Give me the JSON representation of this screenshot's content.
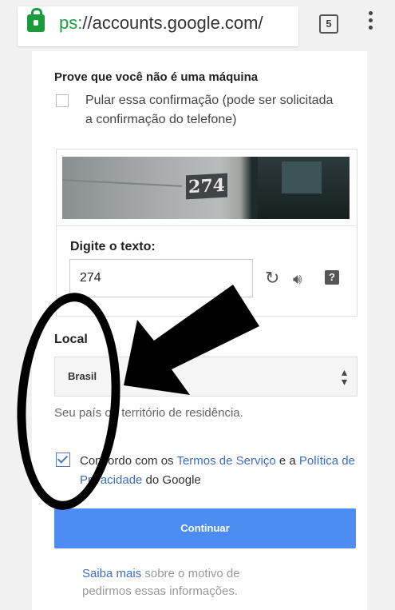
{
  "browser": {
    "url_scheme": "ps:",
    "url_rest": "//accounts.google.com/",
    "tab_count": "5"
  },
  "form": {
    "prove_title": "Prove que você não é uma máquina",
    "skip_label": "Pular essa confirmação (pode ser solicitada a confirmação do telefone)",
    "captcha_image_text": "274",
    "digite_label": "Digite o texto:",
    "captcha_value": "274",
    "local_label": "Local",
    "country_value": "Brasil",
    "country_hint": "Seu país ou território de residência.",
    "agree_prefix": "Concordo com os ",
    "terms_link": "Termos de Serviço",
    "agree_mid": " e a ",
    "privacy_link": "Política de Privacidade",
    "agree_suffix": " do Google",
    "continue_label": "Continuar",
    "learn_more_link": "Saiba mais",
    "learn_more_rest": " sobre o motivo de pedirmos essas informações."
  },
  "colors": {
    "accent": "#4d8cf0",
    "link": "#3b6cc9",
    "secure": "#1a9c3b"
  }
}
